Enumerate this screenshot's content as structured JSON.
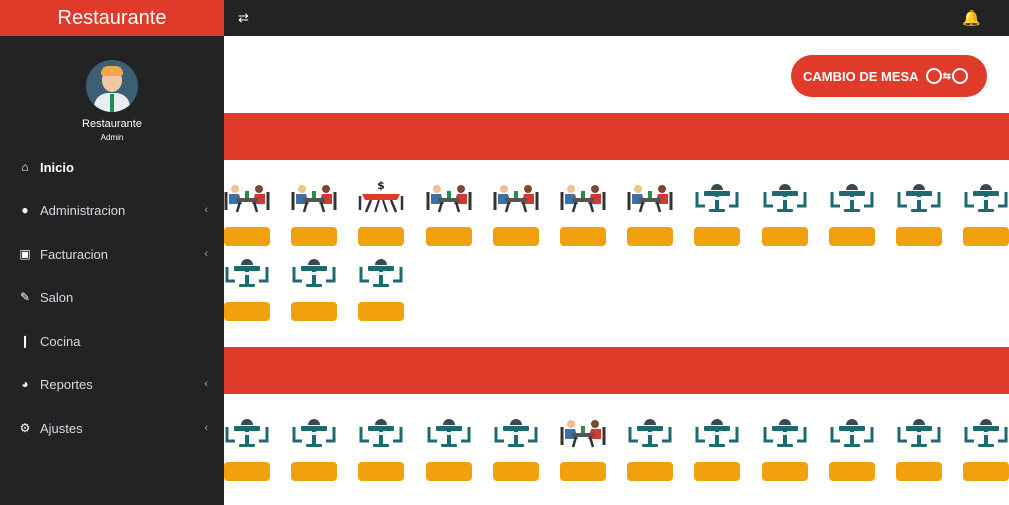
{
  "sidebar": {
    "brand": "Restaurante",
    "user": {
      "name": "Restaurante",
      "role": "Admin"
    },
    "items": [
      {
        "label": "Inicio",
        "icon": "home-icon",
        "chevron": false
      },
      {
        "label": "Administracion",
        "icon": "user-icon",
        "chevron": true
      },
      {
        "label": "Facturacion",
        "icon": "money-icon",
        "chevron": true
      },
      {
        "label": "Salon",
        "icon": "pencil-icon",
        "chevron": false
      },
      {
        "label": "Cocina",
        "icon": "cutlery-icon",
        "chevron": false
      },
      {
        "label": "Reportes",
        "icon": "pie-chart-icon",
        "chevron": true
      },
      {
        "label": "Ajustes",
        "icon": "gear-icon",
        "chevron": true
      }
    ]
  },
  "topbar": {
    "toggle_icon": "swap-arrows-icon",
    "bell_icon": "bell-icon"
  },
  "main": {
    "cambio_label": "CAMBIO DE MESA",
    "sections": [
      {
        "rows": [
          [
            "occupied",
            "occupied",
            "billing",
            "occupied",
            "occupied",
            "occupied",
            "occupied",
            "free",
            "free",
            "free",
            "free",
            "free"
          ],
          [
            "free",
            "free",
            "free"
          ]
        ]
      },
      {
        "rows": [
          [
            "free",
            "free",
            "free",
            "free",
            "free",
            "occupied",
            "free",
            "free",
            "free",
            "free",
            "free",
            "free"
          ]
        ]
      }
    ]
  },
  "colors": {
    "accent": "#e03a2b",
    "sidebar": "#222324",
    "tag": "#f2a10e",
    "free_table": "#1d6a73"
  }
}
